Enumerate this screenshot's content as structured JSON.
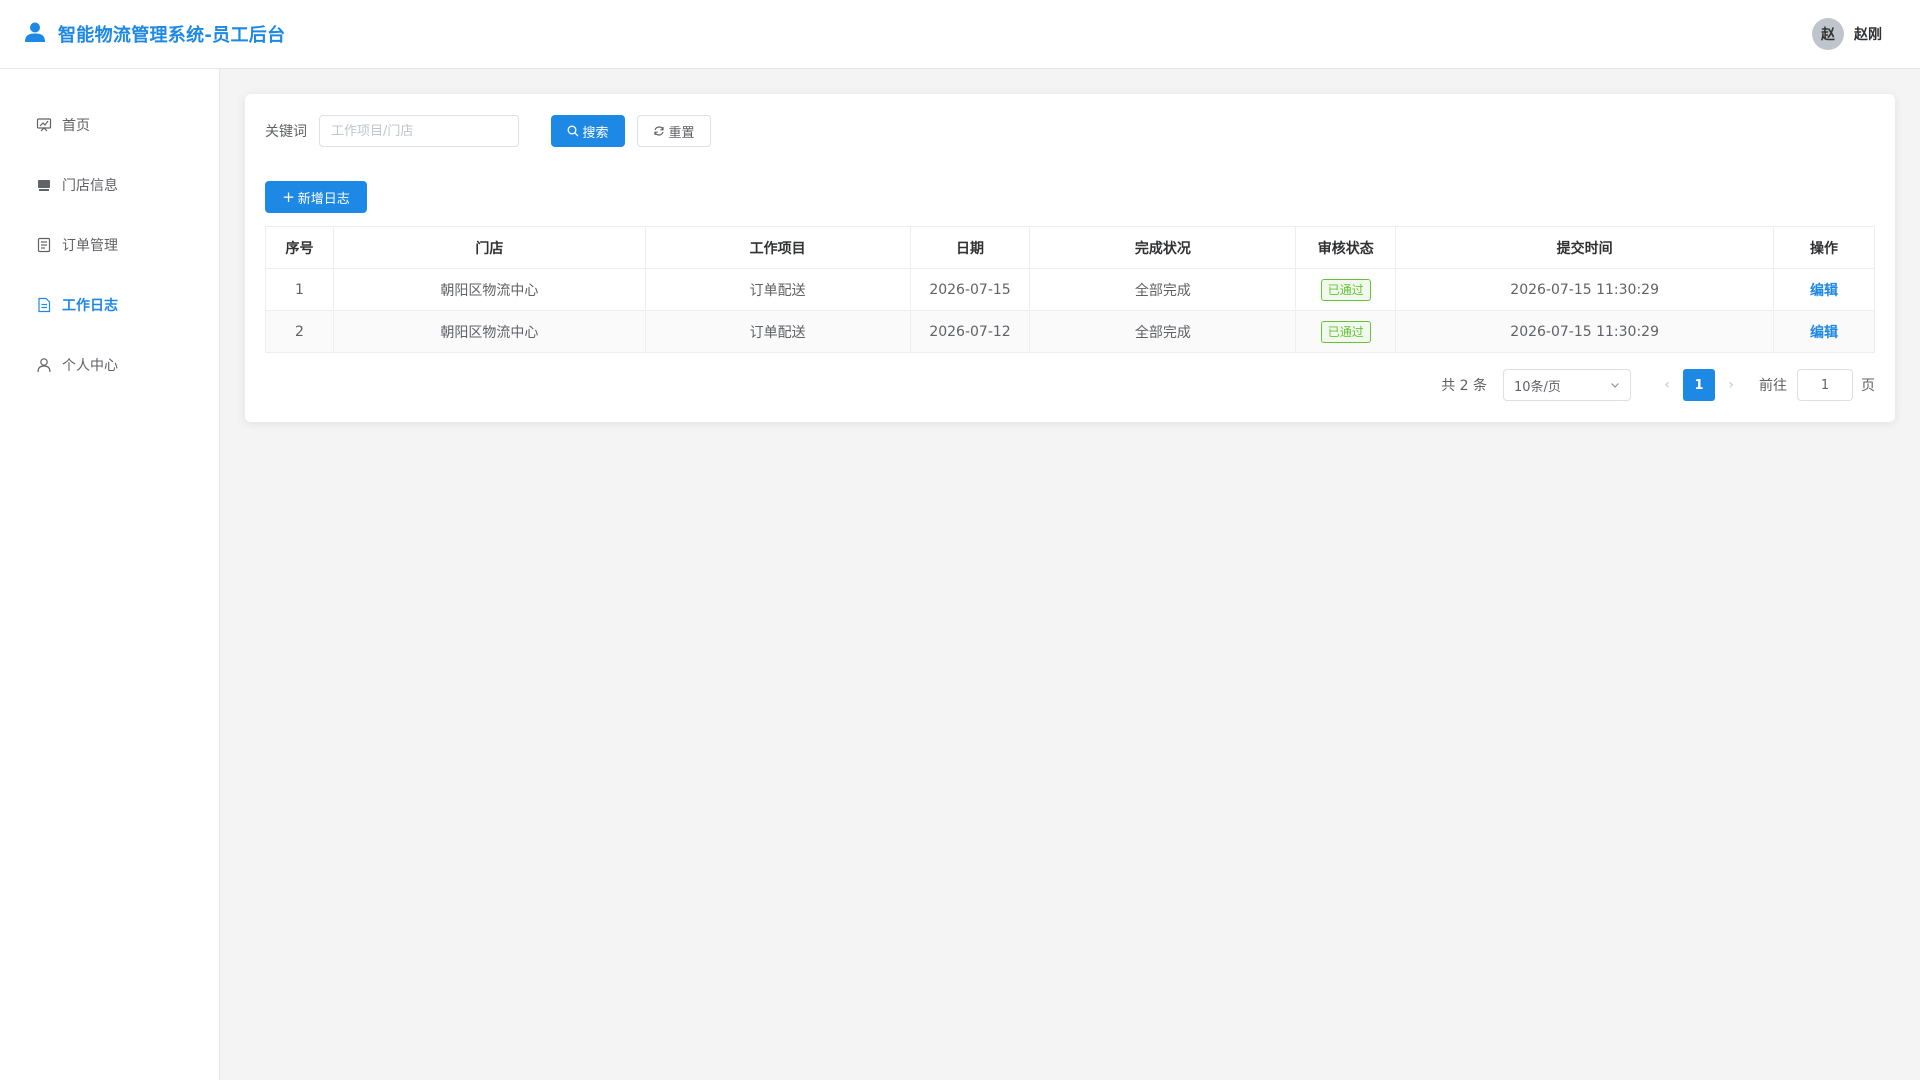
{
  "header": {
    "title": "智能物流管理系统-员工后台",
    "user_avatar": "赵",
    "user_name": "赵刚",
    "brand_color": "#1e88e5"
  },
  "sidebar": {
    "items": [
      {
        "label": "首页",
        "icon": "monitor-icon"
      },
      {
        "label": "门店信息",
        "icon": "store-icon"
      },
      {
        "label": "订单管理",
        "icon": "document-icon"
      },
      {
        "label": "工作日志",
        "icon": "log-icon",
        "active": true
      },
      {
        "label": "个人中心",
        "icon": "user-icon"
      }
    ]
  },
  "search": {
    "label": "关键词",
    "placeholder": "工作项目/门店",
    "value": "",
    "search_label": "搜索",
    "reset_label": "重置"
  },
  "toolbar": {
    "add_label": "新增日志"
  },
  "table": {
    "columns": [
      "序号",
      "门店",
      "工作项目",
      "日期",
      "完成状况",
      "审核状态",
      "提交时间",
      "操作"
    ],
    "rows": [
      {
        "index": "1",
        "store": "朝阳区物流中心",
        "item": "订单配送",
        "date": "2026-07-15",
        "completion": "全部完成",
        "review": "已通过",
        "submitted": "2026-07-15 11:30:29",
        "action": "编辑"
      },
      {
        "index": "2",
        "store": "朝阳区物流中心",
        "item": "订单配送",
        "date": "2026-07-12",
        "completion": "全部完成",
        "review": "已通过",
        "submitted": "2026-07-15 11:30:29",
        "action": "编辑"
      }
    ]
  },
  "pagination": {
    "total": "共 2 条",
    "page_size": "10条/页",
    "current_page": "1",
    "goto_label": "前往",
    "goto_value": "1",
    "goto_suffix": "页"
  }
}
